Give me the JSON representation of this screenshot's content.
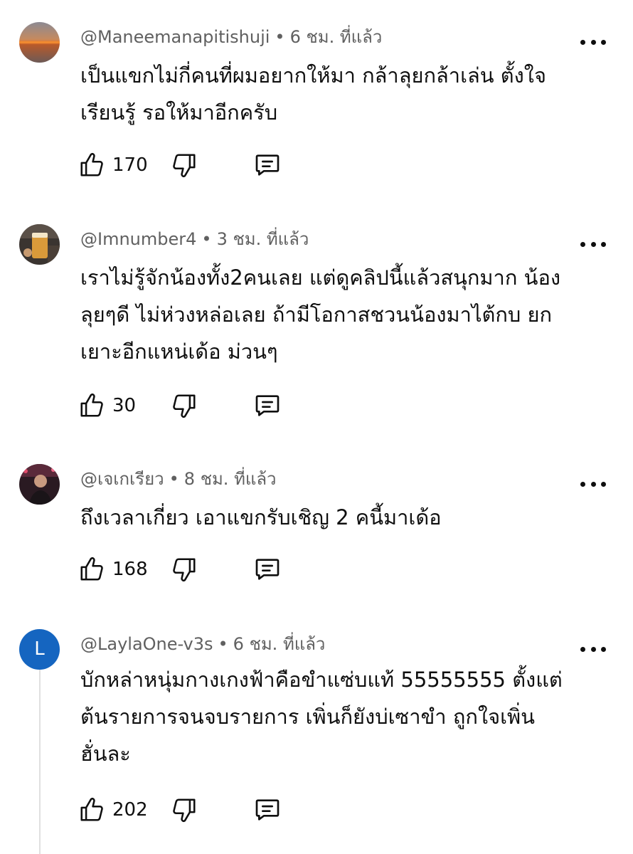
{
  "comments": [
    {
      "author": "@Maneemanapitishuji",
      "time": "6 ชม. ที่แล้ว",
      "lines": [
        "เป็นแขกไม่กี่คนที่ผมอยากให้มา กล้าลุยกล้าเล่น ตั้งใจ",
        "เรียนรู้ รอให้มาอีกครับ"
      ],
      "likes": "170",
      "avatar_icon": "sunset-photo"
    },
    {
      "author": "@Imnumber4",
      "time": "3 ชม. ที่แล้ว",
      "lines": [
        "เราไม่รู้จักน้องทั้ง2คนเลย แต่ดูคลิปนี้แล้วสนุกมาก น้อง",
        "ลุยๆดี ไม่ห่วงหล่อเลย ถ้ามีโอกาสชวนน้องมาไต้กบ ยก",
        "เยาะอีกแหน่เด้อ ม่วนๆ"
      ],
      "likes": "30",
      "avatar_icon": "beer-glass-photo"
    },
    {
      "author": "@เจเกเรียว",
      "time": "8 ชม. ที่แล้ว",
      "lines": [
        "ถึงเวลาเกี่ยว เอาแขกรับเชิญ 2 คนี้มาเด้อ"
      ],
      "likes": "168",
      "avatar_icon": "person-photo"
    },
    {
      "author": "@LaylaOne-v3s",
      "time": "6 ชม. ที่แล้ว",
      "lines": [
        "บักหล่าหนุ่มกางเกงฟ้าคือขำแซ่บแท้ 55555555 ตั้งแต่",
        "ต้นรายการจนจบรายการ เพิ่นก็ยังบ่เซาขำ ถูกใจเพิ่น",
        "ฮั่นละ"
      ],
      "likes": "202",
      "avatar_letter": "L",
      "avatar_color": "#1565c0"
    }
  ],
  "separator": "•",
  "icons": {
    "like": "thumbs-up-icon",
    "dislike": "thumbs-down-icon",
    "reply": "comment-icon",
    "more": "more-horizontal-icon"
  }
}
